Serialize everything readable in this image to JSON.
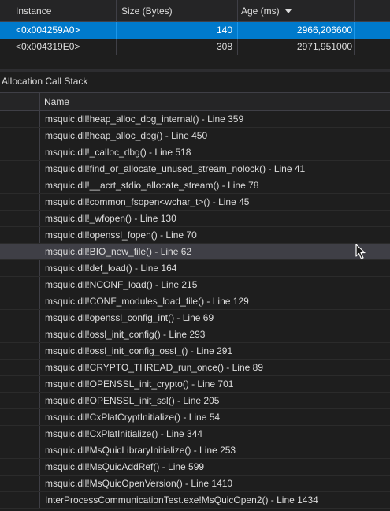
{
  "instances": {
    "columns": [
      "Instance",
      "Size (Bytes)",
      "Age (ms)"
    ],
    "sort": {
      "column": "Age (ms)",
      "direction": "descending"
    },
    "rows": [
      {
        "instance": "<0x004259A0>",
        "size": "140",
        "age": "2966,206600",
        "selected": true
      },
      {
        "instance": "<0x004319E0>",
        "size": "308",
        "age": "2971,951000",
        "selected": false
      }
    ]
  },
  "call_stack": {
    "title": "Allocation Call Stack",
    "column": "Name",
    "rows": [
      "msquic.dll!heap_alloc_dbg_internal() - Line 359",
      "msquic.dll!heap_alloc_dbg() - Line 450",
      "msquic.dll!_calloc_dbg() - Line 518",
      "msquic.dll!find_or_allocate_unused_stream_nolock() - Line 41",
      "msquic.dll!__acrt_stdio_allocate_stream() - Line 78",
      "msquic.dll!common_fsopen<wchar_t>() - Line 45",
      "msquic.dll!_wfopen() - Line 130",
      "msquic.dll!openssl_fopen() - Line 70",
      "msquic.dll!BIO_new_file() - Line 62",
      "msquic.dll!def_load() - Line 164",
      "msquic.dll!NCONF_load() - Line 215",
      "msquic.dll!CONF_modules_load_file() - Line 129",
      "msquic.dll!openssl_config_int() - Line 69",
      "msquic.dll!ossl_init_config() - Line 293",
      "msquic.dll!ossl_init_config_ossl_() - Line 291",
      "msquic.dll!CRYPTO_THREAD_run_once() - Line 89",
      "msquic.dll!OPENSSL_init_crypto() - Line 701",
      "msquic.dll!OPENSSL_init_ssl() - Line 205",
      "msquic.dll!CxPlatCryptInitialize() - Line 54",
      "msquic.dll!CxPlatInitialize() - Line 344",
      "msquic.dll!MsQuicLibraryInitialize() - Line 253",
      "msquic.dll!MsQuicAddRef() - Line 599",
      "msquic.dll!MsQuicOpenVersion() - Line 1410",
      "InterProcessCommunicationTest.exe!MsQuicOpen2() - Line 1434"
    ],
    "hovered_row": 8
  },
  "colors": {
    "background": "#1e1e1e",
    "selection": "#007acc",
    "hover": "#3f3f46",
    "text": "#dcdcdc"
  }
}
